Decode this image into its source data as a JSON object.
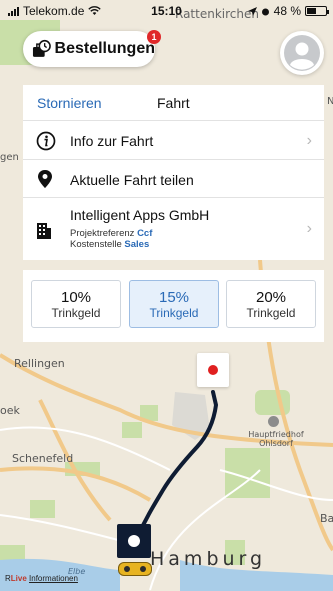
{
  "status_bar": {
    "carrier": "Telekom.de",
    "time": "15:10",
    "battery": "48 %",
    "battery_level": 0.48
  },
  "header": {
    "orders_label": "Bestellungen",
    "orders_badge": "1"
  },
  "panel": {
    "cancel_label": "Stornieren",
    "title": "Fahrt",
    "rows": [
      {
        "label": "Info zur Fahrt",
        "icon": "info-icon"
      },
      {
        "label": "Aktuelle Fahrt teilen",
        "icon": "location-pin-icon"
      },
      {
        "label": "Intelligent Apps GmbH",
        "icon": "building-icon",
        "project_ref_label": "Projektreferenz",
        "project_ref_value": "Ccf",
        "cost_center_label": "Kostenstelle",
        "cost_center_value": "Sales"
      }
    ]
  },
  "tips": [
    {
      "percent": "10%",
      "label": "Trinkgeld",
      "selected": false
    },
    {
      "percent": "15%",
      "label": "Trinkgeld",
      "selected": true
    },
    {
      "percent": "20%",
      "label": "Trinkgeld",
      "selected": false
    }
  ],
  "map": {
    "labels": {
      "top_place": "Rattenkirchen",
      "rellingen": "Rellingen",
      "schenefeld": "Schenefeld",
      "cemetery": "Hauptfriedhof Ohlsdorf",
      "elbe": "Elbe",
      "hamburg": "Hamburg",
      "left_edge_top": "gen",
      "left_edge_mid": "oek",
      "right_edge_top": "N",
      "right_edge_bottom": "Ba"
    },
    "footer_brand": "Live",
    "footer_link": "Informationen",
    "footer_prefix": "R"
  },
  "colors": {
    "accent": "#2a6ab6",
    "route": "#0f1c33",
    "badge": "#e0282a",
    "destination": "#e02020",
    "taxi": "#e7b321"
  }
}
